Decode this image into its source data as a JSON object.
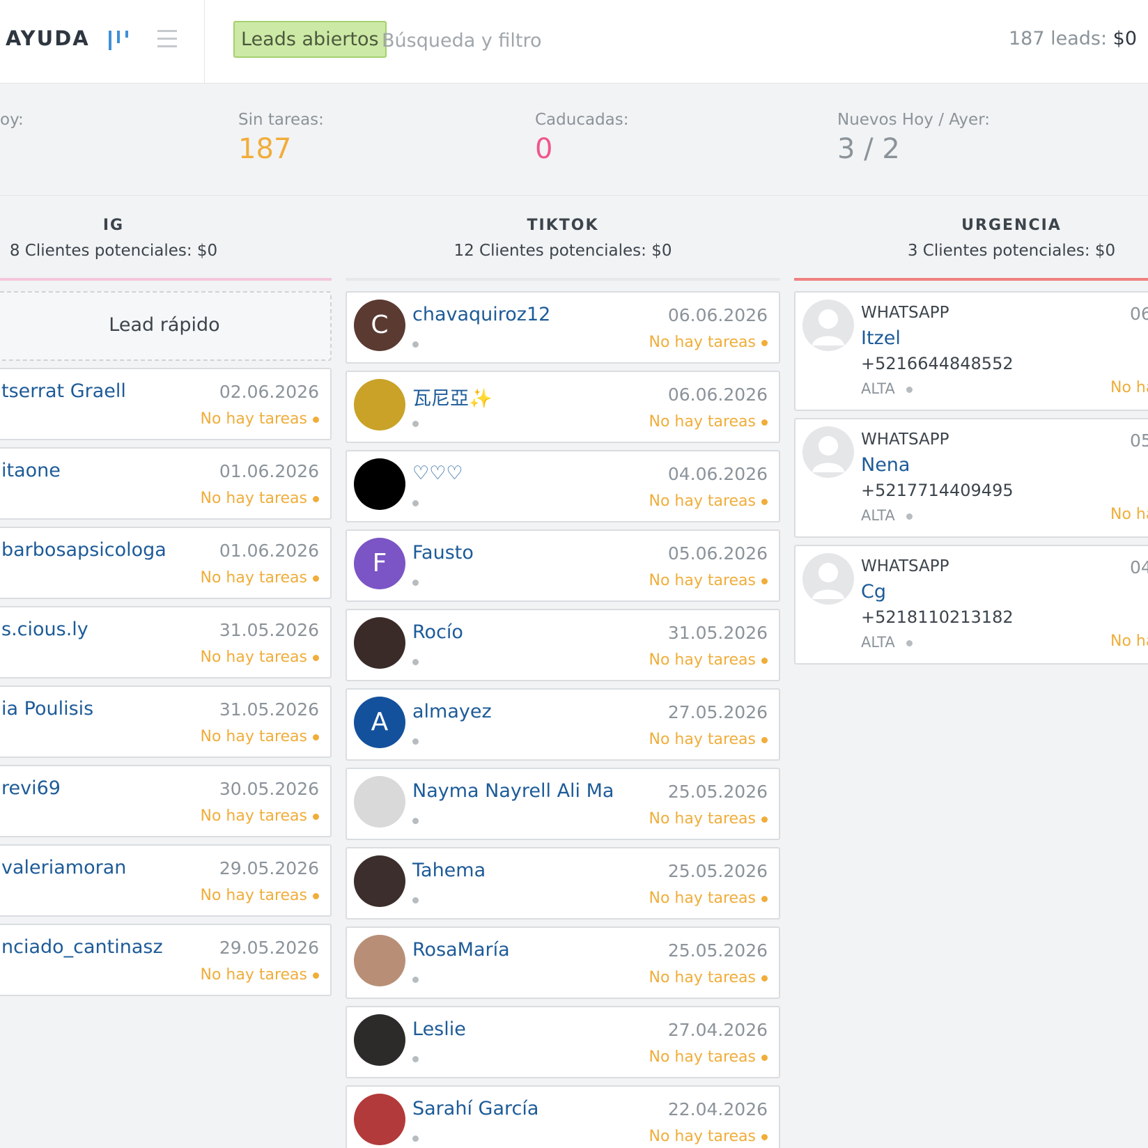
{
  "header": {
    "help_label": "AYUDA",
    "open_leads_tag": "Leads abiertos",
    "search_placeholder": "Búsqueda y filtro",
    "leads_summary_label": "187 leads:",
    "leads_summary_amount": "$0"
  },
  "stats": [
    {
      "label": "oy:",
      "value": ""
    },
    {
      "label": "Sin tareas:",
      "value": "187"
    },
    {
      "label": "Caducadas:",
      "value": "0"
    },
    {
      "label": "Nuevos Hoy / Ayer:",
      "value": "3 / 2"
    }
  ],
  "columns": {
    "ig": {
      "title": "IG",
      "subtitle": "8 Clientes potenciales: $0",
      "color": "#f3c6dc",
      "quick_lead": "Lead rápido",
      "cards": [
        {
          "name": "tserrat Graell",
          "date": "02.06.2026",
          "tasks": "No hay tareas"
        },
        {
          "name": "itaone",
          "date": "01.06.2026",
          "tasks": "No hay tareas"
        },
        {
          "name": "barbosapsicologa",
          "date": "01.06.2026",
          "tasks": "No hay tareas"
        },
        {
          "name": "s.cious.ly",
          "date": "31.05.2026",
          "tasks": "No hay tareas"
        },
        {
          "name": "ia Poulisis",
          "date": "31.05.2026",
          "tasks": "No hay tareas"
        },
        {
          "name": "revi69",
          "date": "30.05.2026",
          "tasks": "No hay tareas"
        },
        {
          "name": "valeriamoran",
          "date": "29.05.2026",
          "tasks": "No hay tareas"
        },
        {
          "name": "nciado_cantinasz",
          "date": "29.05.2026",
          "tasks": "No hay tareas"
        }
      ]
    },
    "tiktok": {
      "title": "TIKTOK",
      "subtitle": "12 Clientes potenciales: $0",
      "color": "#e6e8ea",
      "cards": [
        {
          "name": "chavaquiroz12",
          "date": "06.06.2026",
          "tasks": "No hay tareas",
          "avatar_letter": "C",
          "avatar_color": "#5b3a32"
        },
        {
          "name": "瓦尼亞✨",
          "date": "06.06.2026",
          "tasks": "No hay tareas",
          "avatar_letter": "",
          "avatar_color": "#c9a227"
        },
        {
          "name": "♡♡♡",
          "date": "04.06.2026",
          "tasks": "No hay tareas",
          "avatar_letter": "",
          "avatar_color": "#000000"
        },
        {
          "name": "Fausto",
          "date": "05.06.2026",
          "tasks": "No hay tareas",
          "avatar_letter": "F",
          "avatar_color": "#7b55c6"
        },
        {
          "name": "Rocío",
          "date": "31.05.2026",
          "tasks": "No hay tareas",
          "avatar_letter": "",
          "avatar_color": "#3a2b28"
        },
        {
          "name": "almayez",
          "date": "27.05.2026",
          "tasks": "No hay tareas",
          "avatar_letter": "A",
          "avatar_color": "#14519c"
        },
        {
          "name": "Nayma Nayrell Ali Ma",
          "date": "25.05.2026",
          "tasks": "No hay tareas",
          "avatar_letter": "",
          "avatar_color": "#d9d9d9"
        },
        {
          "name": "Tahema",
          "date": "25.05.2026",
          "tasks": "No hay tareas",
          "avatar_letter": "",
          "avatar_color": "#3b2e2c"
        },
        {
          "name": "RosaMaría",
          "date": "25.05.2026",
          "tasks": "No hay tareas",
          "avatar_letter": "",
          "avatar_color": "#b88f76"
        },
        {
          "name": "Leslie",
          "date": "27.04.2026",
          "tasks": "No hay tareas",
          "avatar_letter": "",
          "avatar_color": "#2d2a2a"
        },
        {
          "name": "Sarahí García",
          "date": "22.04.2026",
          "tasks": "No hay tareas",
          "avatar_letter": "",
          "avatar_color": "#b33a3a"
        }
      ]
    },
    "urgencia": {
      "title": "URGENCIA",
      "subtitle": "3 Clientes potenciales: $0",
      "color": "#f08080",
      "cards": [
        {
          "source": "WHATSAPP",
          "name": "Itzel",
          "phone": "+5216644848552",
          "priority": "ALTA",
          "date": "06",
          "tasks": "No ha"
        },
        {
          "source": "WHATSAPP",
          "name": "Nena",
          "phone": "+5217714409495",
          "priority": "ALTA",
          "date": "05",
          "tasks": "No ha"
        },
        {
          "source": "WHATSAPP",
          "name": "Cg",
          "phone": "+5218110213182",
          "priority": "ALTA",
          "date": "04",
          "tasks": "No ha"
        }
      ]
    }
  },
  "icons": {
    "pipeline": "pipeline-view-icon",
    "list": "list-view-icon",
    "default_avatar": "default-avatar-icon"
  }
}
